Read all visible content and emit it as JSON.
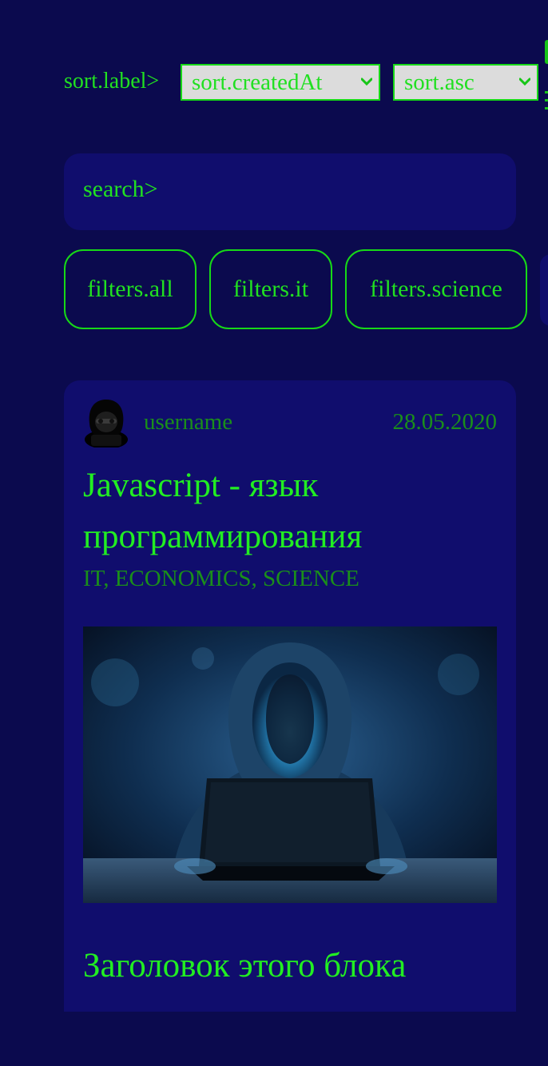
{
  "sort": {
    "label": "sort.label>",
    "field_value": "sort.createdAt",
    "order_value": "sort.asc"
  },
  "search": {
    "label": "search>"
  },
  "filters": [
    {
      "label": "filters.all"
    },
    {
      "label": "filters.it"
    },
    {
      "label": "filters.science"
    }
  ],
  "post": {
    "username": "username",
    "date": "28.05.2020",
    "title": "Javascript - язык программирования",
    "tags": "IT, ECONOMICS, SCIENCE",
    "image_icon": "hooded-hacker-image",
    "block_title": "Заголовок этого блока"
  },
  "colors": {
    "background": "#0b0a4e",
    "card": "#100d6d",
    "accent_green": "#21e021",
    "muted_green": "#1a8f1a",
    "select_bg": "#dcdcdc"
  }
}
